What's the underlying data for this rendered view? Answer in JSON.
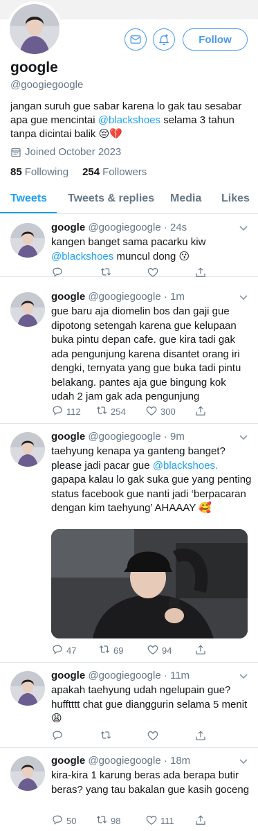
{
  "profile": {
    "display_name": "google",
    "handle": "@googiegoogle",
    "bio_pre": "jangan suruh gue sabar karena lo gak tau sesabar apa gue mencintai ",
    "bio_mention": "@blackshoes",
    "bio_post": " selama 3 tahun tanpa dicintai balik 😔💔",
    "joined": "Joined October 2023",
    "following_count": "85",
    "following_label": "Following",
    "followers_count": "254",
    "followers_label": "Followers",
    "follow_label": "Follow"
  },
  "tabs": [
    "Tweets",
    "Tweets & replies",
    "Media",
    "Likes"
  ],
  "tweets": [
    {
      "name": "google",
      "meta": "@googiegoogle · 24s",
      "line1": "kangen banget sama pacarku kiw",
      "mention": "@blackshoes",
      "line2": " muncul dong 😗",
      "replies": "",
      "retweets": "",
      "likes": ""
    },
    {
      "name": "google",
      "meta": "@googiegoogle · 1m",
      "text": "gue baru aja diomelin bos dan gaji gue dipotong setengah karena gue kelupaan buka pintu depan cafe. gue kira tadi gak ada pengunjung karena disantet orang iri dengki, ternyata yang gue buka tadi pintu belakang. pantes aja gue bingung kok udah 2 jam gak ada pengunjung",
      "replies": "112",
      "retweets": "254",
      "likes": "300"
    },
    {
      "name": "google",
      "meta": "@googiegoogle · 9m",
      "pre": "taehyung kenapa ya ganteng banget? please jadi pacar gue ",
      "mention": "@blackshoes.",
      "post": " gapapa kalau lo gak suka gue yang penting status facebook gue nanti jadi ‘berpacaran dengan kim taehyung’ AHAAAY 🥰",
      "replies": "47",
      "retweets": "69",
      "likes": "94"
    },
    {
      "name": "google",
      "meta": "@googiegoogle · 11m",
      "text": "apakah taehyung udah ngelupain gue? hufftttt chat gue dianggurin selama 5 menit 😩",
      "replies": "",
      "retweets": "",
      "likes": ""
    },
    {
      "name": "google",
      "meta": "@googiegoogle · 18m",
      "text": "kira-kira 1 karung beras ada berapa butir beras? yang tau bakalan gue kasih goceng",
      "replies": "50",
      "retweets": "98",
      "likes": "111"
    }
  ],
  "colors": {
    "accent": "#1da1f2",
    "muted": "#657786",
    "border": "#e1e8ed"
  }
}
